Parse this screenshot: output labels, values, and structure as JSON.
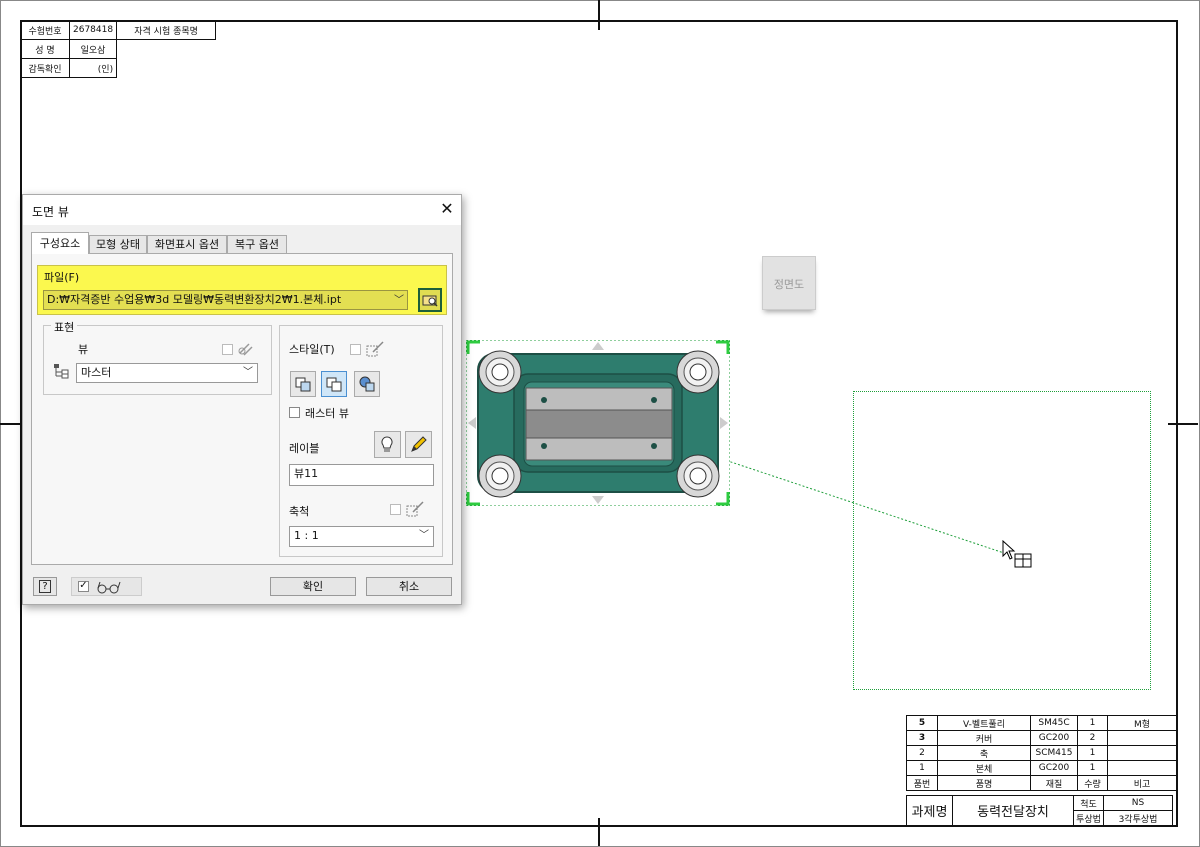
{
  "candidate": {
    "exam_no_label": "수험번호",
    "exam_no": "2678418",
    "event_label": "자격 시험 종목명",
    "name_label": "성   명",
    "name": "일오삼",
    "supervisor_label": "감독확인",
    "seal": "(인)"
  },
  "view_marker": "정면도",
  "bom": {
    "rows": [
      [
        "5",
        "V-벨트풀리",
        "SM45C",
        "1",
        "M형"
      ],
      [
        "3",
        "커버",
        "GC200",
        "2",
        ""
      ],
      [
        "2",
        "축",
        "SCM415",
        "1",
        ""
      ],
      [
        "1",
        "본체",
        "GC200",
        "1",
        ""
      ]
    ],
    "header": [
      "품번",
      "품명",
      "재질",
      "수량",
      "비고"
    ],
    "project_label": "과제명",
    "project_name": "동력전달장치",
    "scale_label": "척도",
    "scale_value": "NS",
    "projection_label": "투상법",
    "projection_value": "3각투상법"
  },
  "dialog": {
    "title": "도면 뷰",
    "tabs": [
      "구성요소",
      "모형 상태",
      "화면표시 옵션",
      "복구 옵션"
    ],
    "file_label": "파일(F)",
    "file_path": "D:₩자격증반 수업용₩3d 모델링₩동력변환장치2₩1.본체.ipt",
    "representation_label": "표현",
    "view_label": "뷰",
    "view_value": "마스터",
    "style_label": "스타일(T)",
    "raster_label": "래스터 뷰",
    "label_label": "레이블",
    "label_value": "뷰11",
    "scale_label": "축척",
    "scale_value": "1 : 1",
    "ok": "확인",
    "cancel": "취소",
    "help": "?"
  },
  "colors": {
    "highlight": "#fbf84e",
    "selection": "#2ecc40",
    "part_body": "#2e7d6e"
  }
}
